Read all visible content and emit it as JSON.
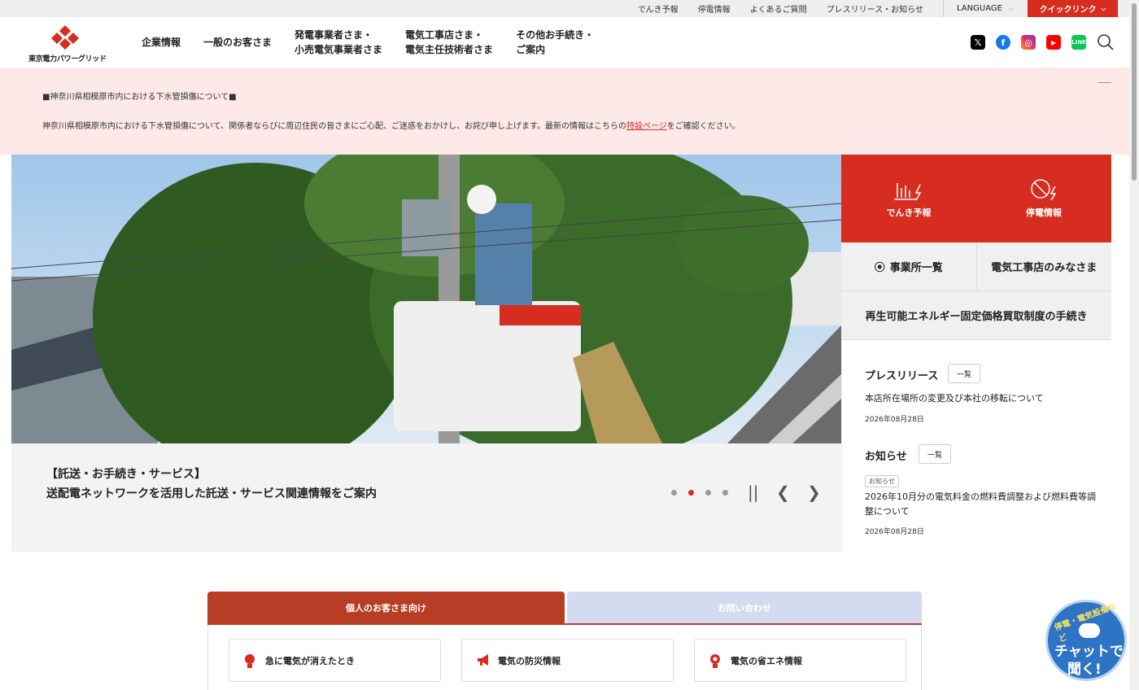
{
  "topbar": {
    "links": [
      "でんき予報",
      "停電情報",
      "よくあるご質問",
      "プレスリリース・お知らせ"
    ],
    "language": "LANGUAGE",
    "quicklink": "クイックリンク"
  },
  "header": {
    "logo_text": "東京電力パワーグリッド",
    "nav": [
      {
        "line1": "企業情報",
        "line2": ""
      },
      {
        "line1": "一般のお客さま",
        "line2": ""
      },
      {
        "line1": "発電事業者さま・",
        "line2": "小売電気事業者さま"
      },
      {
        "line1": "電気工事店さま・",
        "line2": "電気主任技術者さま"
      },
      {
        "line1": "その他お手続き・",
        "line2": "ご案内"
      }
    ],
    "social_icons": [
      "x-icon",
      "facebook-icon",
      "instagram-icon",
      "youtube-icon",
      "line-icon",
      "search-icon"
    ]
  },
  "notice": {
    "title": "■神奈川県相模原市内における下水管損傷について■",
    "body_before": "神奈川県相模原市内における下水管損傷について、関係者ならびに周辺住民の皆さまにご心配、ご迷惑をおかけし、お詫び申し上げます。最新の情報はこちらの",
    "link": "特設ページ",
    "body_after": "をご確認ください。"
  },
  "hero": {
    "caption_line1": "【託送・お手続き・サービス】",
    "caption_line2": "送配電ネットワークを活用した託送・サービス関連情報をご案内",
    "slide_count": 4,
    "active_slide": 2
  },
  "right_panel": {
    "forecast": "でんき予報",
    "outage": "停電情報",
    "offices": "事業所一覧",
    "electricians": "電気工事店のみなさま",
    "renewable": "再生可能エネルギー固定価格買取制度の手続き",
    "press": {
      "heading": "プレスリリース",
      "list_button": "一覧",
      "title": "本店所在場所の変更及び本社の移転について",
      "date": "2026年08月28日"
    },
    "news": {
      "heading": "お知らせ",
      "list_button": "一覧",
      "tag": "お知らせ",
      "title": "2026年10月分の電気料金の燃料費調整および燃料費等調整について",
      "date": "2026年08月28日"
    }
  },
  "tabs": {
    "active": "個人のお客さま向け",
    "inactive": "お問い合わせ",
    "cards": [
      "急に電気が消えたとき",
      "電気の防災情報",
      "電気の省エネ情報"
    ]
  },
  "chat": {
    "top": "停電・電気設備など",
    "line1": "チャットで",
    "line2": "聞く!"
  },
  "colors": {
    "brand_red": "#d62d20",
    "tab_red": "#b83d25",
    "notice_bg": "#fce9e8",
    "chat_blue": "#2d74c6"
  }
}
